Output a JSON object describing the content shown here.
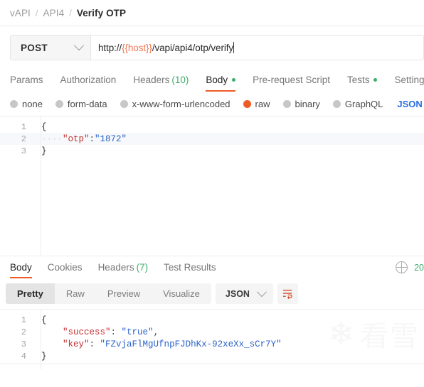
{
  "breadcrumb": {
    "items": [
      "vAPI",
      "API4",
      "Verify OTP"
    ],
    "separator": "/"
  },
  "request": {
    "method": "POST",
    "url_prefix": "http://",
    "url_variable": "{{host}}",
    "url_suffix": "/vapi/api4/otp/verify",
    "tabs": [
      {
        "label": "Params",
        "count": "",
        "dot": false,
        "active": false
      },
      {
        "label": "Authorization",
        "count": "",
        "dot": false,
        "active": false
      },
      {
        "label": "Headers",
        "count": "(10)",
        "dot": false,
        "active": false
      },
      {
        "label": "Body",
        "count": "",
        "dot": true,
        "active": true
      },
      {
        "label": "Pre-request Script",
        "count": "",
        "dot": false,
        "active": false
      },
      {
        "label": "Tests",
        "count": "",
        "dot": true,
        "active": false
      },
      {
        "label": "Settings",
        "count": "",
        "dot": false,
        "active": false
      }
    ],
    "body_types": [
      {
        "label": "none",
        "checked": false
      },
      {
        "label": "form-data",
        "checked": false
      },
      {
        "label": "x-www-form-urlencoded",
        "checked": false
      },
      {
        "label": "raw",
        "checked": true
      },
      {
        "label": "binary",
        "checked": false
      },
      {
        "label": "GraphQL",
        "checked": false
      }
    ],
    "raw_format": "JSON",
    "body_lines": [
      {
        "number": "1",
        "open": "{",
        "indent": "",
        "key": "",
        "punct": "",
        "value": "",
        "close": "",
        "active": false
      },
      {
        "number": "2",
        "open": "",
        "indent": "····",
        "key": "\"otp\"",
        "punct": ":",
        "value": "\"1872\"",
        "close": "",
        "active": true
      },
      {
        "number": "3",
        "open": "}",
        "indent": "",
        "key": "",
        "punct": "",
        "value": "",
        "close": "",
        "active": false
      }
    ]
  },
  "response": {
    "tabs": [
      {
        "label": "Body",
        "count": "",
        "active": true
      },
      {
        "label": "Cookies",
        "count": "",
        "active": false
      },
      {
        "label": "Headers",
        "count": "(7)",
        "active": false
      },
      {
        "label": "Test Results",
        "count": "",
        "active": false
      }
    ],
    "status_code": "20",
    "view_modes": [
      {
        "label": "Pretty",
        "active": true
      },
      {
        "label": "Raw",
        "active": false
      },
      {
        "label": "Preview",
        "active": false
      },
      {
        "label": "Visualize",
        "active": false
      }
    ],
    "format": "JSON",
    "body_lines": [
      {
        "number": "1",
        "open": "{",
        "indent": "",
        "key": "",
        "punct": "",
        "value": "",
        "trail": "",
        "active": false
      },
      {
        "number": "2",
        "open": "",
        "indent": "    ",
        "key": "\"success\"",
        "punct": ": ",
        "value": "\"true\"",
        "trail": ",",
        "active": false
      },
      {
        "number": "3",
        "open": "",
        "indent": "    ",
        "key": "\"key\"",
        "punct": ": ",
        "value": "\"FZvjaFlMgUfnpFJDhKx-92xeXx_sCr7Y\"",
        "trail": "",
        "active": false
      },
      {
        "number": "4",
        "open": "}",
        "indent": "",
        "key": "",
        "punct": "",
        "value": "",
        "trail": "",
        "active": false
      }
    ]
  },
  "watermark": {
    "snowflake": "❄",
    "text": "看雪"
  },
  "colors": {
    "accent": "#ef5b25",
    "success": "#3dae6a",
    "link": "#2a6fdb",
    "string": "#2b62c9",
    "key": "#c62f2f",
    "variable": "#f07855"
  }
}
